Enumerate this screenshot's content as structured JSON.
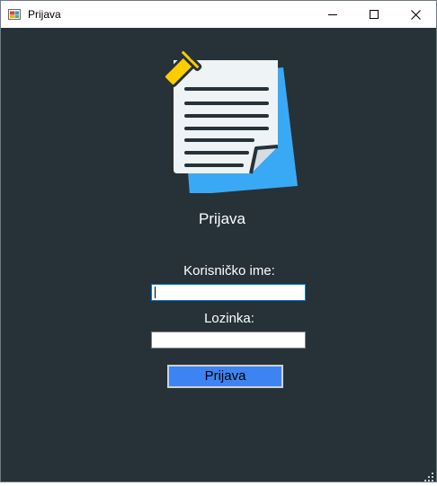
{
  "window": {
    "title": "Prijava",
    "controls": [
      "minimize",
      "maximize",
      "close"
    ]
  },
  "form": {
    "heading": "Prijava",
    "username_label": "Korisničko ime:",
    "username_value": "",
    "password_label": "Lozinka:",
    "password_value": "",
    "submit_label": "Prijava"
  },
  "icons": {
    "logo": "pinned-note-icon",
    "app": "window-app-icon"
  },
  "colors": {
    "background": "#263238",
    "button": "#3d84f2",
    "text": "#ffffff",
    "note": "#eef3f6",
    "note_shadow": "#3aa9f5",
    "pin": "#ffcc00"
  }
}
